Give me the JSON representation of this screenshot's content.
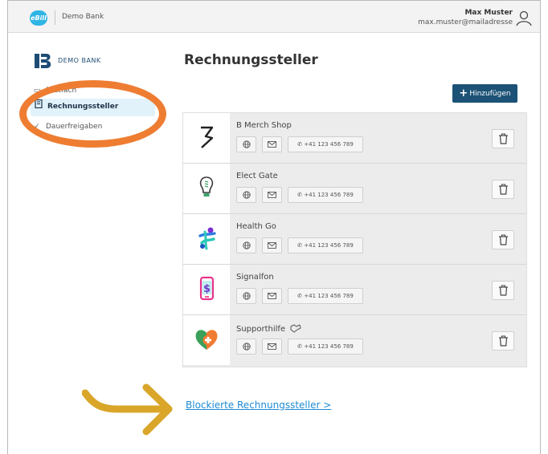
{
  "header": {
    "ebill_logo": "eBill",
    "bank_name": "Demo Bank",
    "user_name": "Max Muster",
    "user_email": "max.muster@mailadresse"
  },
  "sidebar": {
    "logo_text": "DEMO BANK",
    "items": [
      {
        "label": "Postfach",
        "icon": "inbox-icon"
      },
      {
        "label": "Rechnungssteller",
        "icon": "document-icon",
        "active": true
      },
      {
        "label": "Dauerfreigaben",
        "icon": "check-icon"
      }
    ]
  },
  "main": {
    "title": "Rechnungssteller",
    "add_button_label": "Hinzufügen",
    "billers": [
      {
        "name": "B Merch Shop",
        "phone": "+41 123 456 789",
        "logo": "b-merch-logo"
      },
      {
        "name": "Elect Gate",
        "phone": "+41 123 456 789",
        "logo": "lightbulb-logo"
      },
      {
        "name": "Health Go",
        "phone": "+41 123 456 789",
        "logo": "health-go-logo"
      },
      {
        "name": "Signalfon",
        "phone": "+41 123 456 789",
        "logo": "phone-logo"
      },
      {
        "name": "Supporthilfe",
        "phone": "+41 123 456 789",
        "logo": "heart-logo"
      }
    ],
    "blocked_link": "Blockierte Rechnungssteller >"
  },
  "colors": {
    "accent": "#1c5276",
    "highlight_ellipse": "#ee7d32",
    "arrow": "#d9a62a",
    "link": "#1e8bd3"
  }
}
